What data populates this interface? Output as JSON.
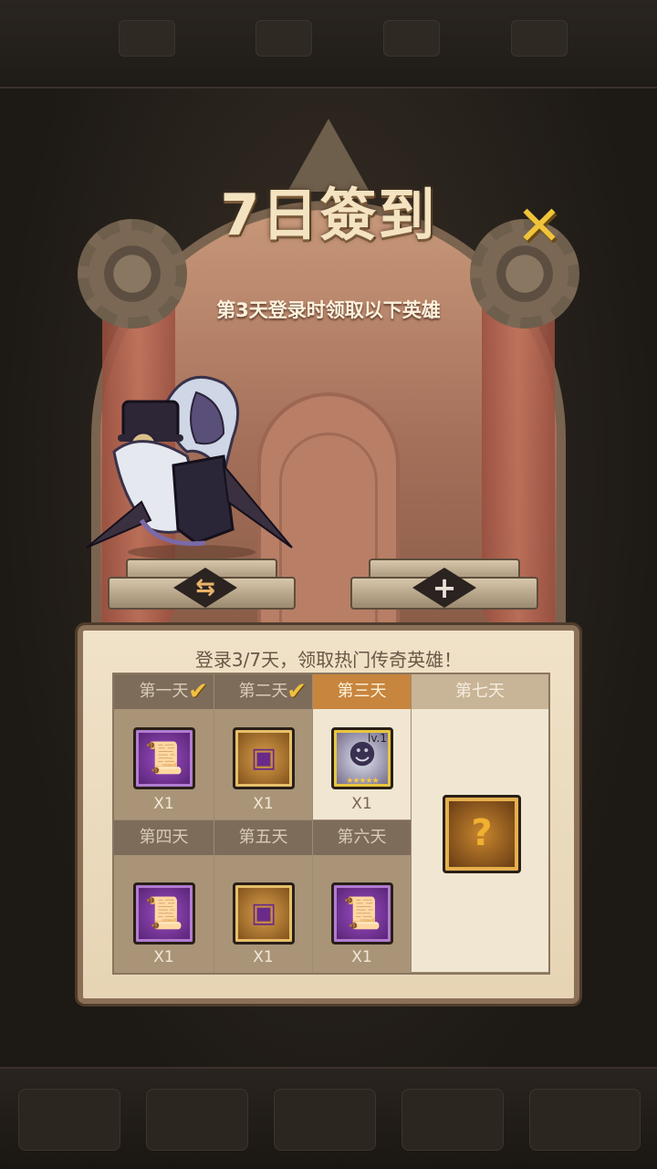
{
  "header": {
    "title": "7日簽到",
    "subtitle": "第3天登录时领取以下英雄"
  },
  "stage": {
    "swap_symbol": "⇆",
    "add_symbol": "+"
  },
  "panel": {
    "title": "登录3/7天，领取热门传奇英雄！",
    "days": [
      {
        "label": "第一天",
        "claimed": true,
        "item": "scroll",
        "qty": "X1"
      },
      {
        "label": "第二天",
        "claimed": true,
        "item": "chest",
        "qty": "X1"
      },
      {
        "label": "第三天",
        "claimed": false,
        "item": "hero",
        "qty": "X1",
        "hero_level": "lv.1",
        "stars": 5
      },
      {
        "label": "第四天",
        "claimed": false,
        "item": "scroll",
        "qty": "X1"
      },
      {
        "label": "第五天",
        "claimed": false,
        "item": "chest",
        "qty": "X1"
      },
      {
        "label": "第六天",
        "claimed": false,
        "item": "scroll",
        "qty": "X1"
      },
      {
        "label": "第七天",
        "claimed": false,
        "item": "mystery-hero"
      }
    ]
  },
  "colors": {
    "active_day": "#c7853e",
    "check": "#f0c040",
    "close": "#f0c43a"
  }
}
